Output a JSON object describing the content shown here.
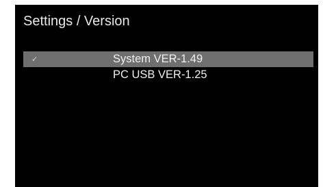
{
  "header": {
    "title": "Settings / Version"
  },
  "menu": {
    "items": [
      {
        "label": "System VER-1.49",
        "selected": true,
        "check_icon": "check-icon"
      },
      {
        "label": "PC USB VER-1.25",
        "selected": false
      }
    ]
  },
  "colors": {
    "background": "#000000",
    "selection_bar": "#6f6f6f",
    "text": "#f0f0f0"
  }
}
